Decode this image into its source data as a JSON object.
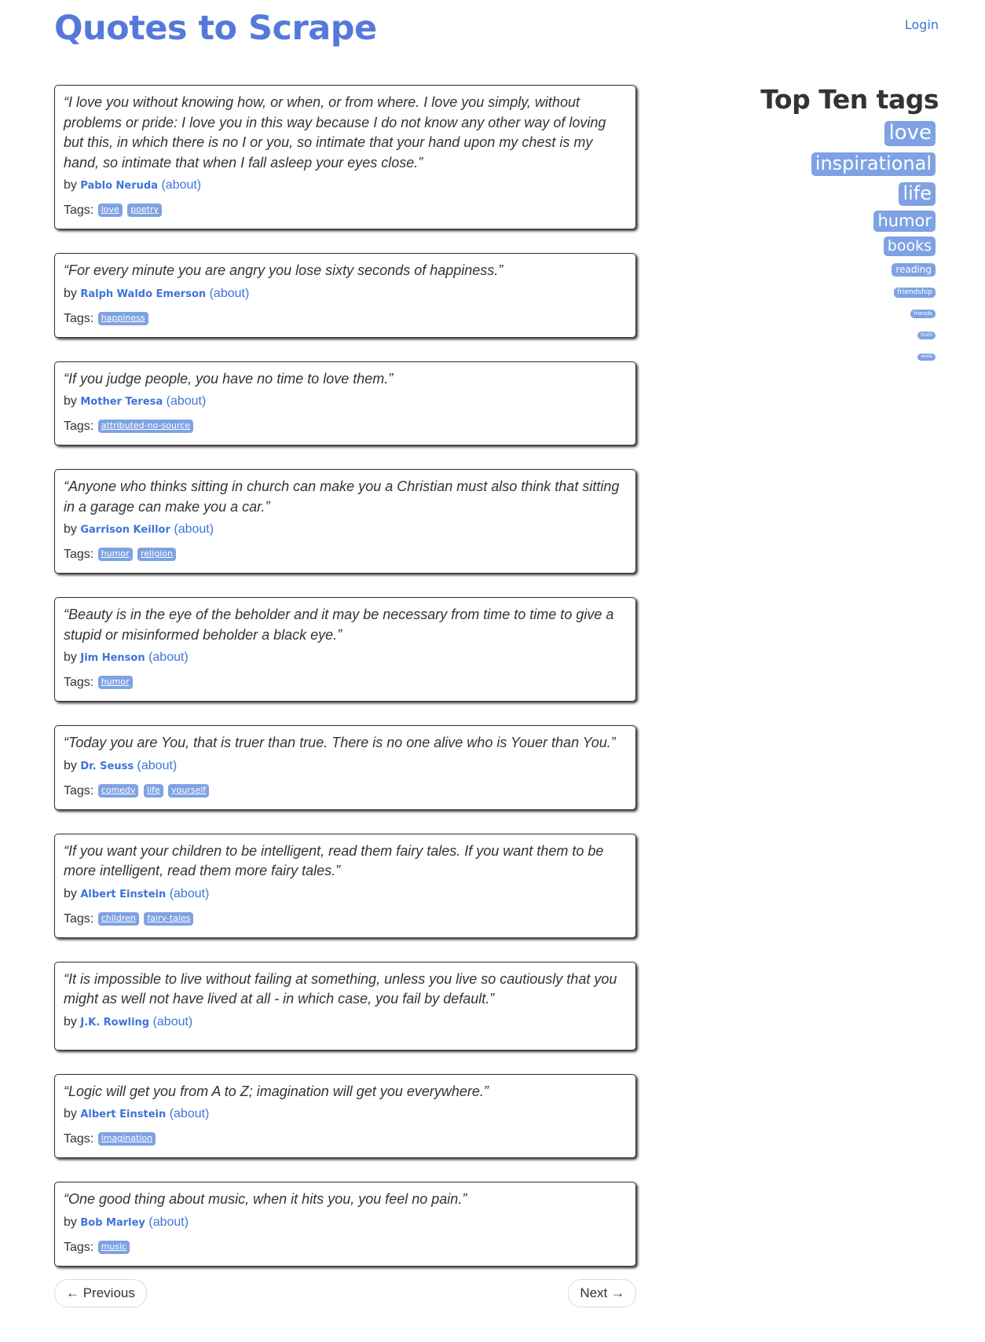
{
  "header": {
    "title": "Quotes to Scrape",
    "login": "Login"
  },
  "quotes": [
    {
      "text": "“I love you without knowing how, or when, or from where. I love you simply, without problems or pride: I love you in this way because I do not know any other way of loving but this, in which there is no I or you, so intimate that your hand upon my chest is my hand, so intimate that when I fall asleep your eyes close.”",
      "author": "Pablo Neruda",
      "tags": [
        "love",
        "poetry"
      ]
    },
    {
      "text": "“For every minute you are angry you lose sixty seconds of happiness.”",
      "author": "Ralph Waldo Emerson",
      "tags": [
        "happiness"
      ]
    },
    {
      "text": "“If you judge people, you have no time to love them.”",
      "author": "Mother Teresa",
      "tags": [
        "attributed-no-source"
      ]
    },
    {
      "text": "“Anyone who thinks sitting in church can make you a Christian must also think that sitting in a garage can make you a car.”",
      "author": "Garrison Keillor",
      "tags": [
        "humor",
        "religion"
      ]
    },
    {
      "text": "“Beauty is in the eye of the beholder and it may be necessary from time to time to give a stupid or misinformed beholder a black eye.”",
      "author": "Jim Henson",
      "tags": [
        "humor"
      ]
    },
    {
      "text": "“Today you are You, that is truer than true. There is no one alive who is Youer than You.”",
      "author": "Dr. Seuss",
      "tags": [
        "comedy",
        "life",
        "yourself"
      ]
    },
    {
      "text": "“If you want your children to be intelligent, read them fairy tales. If you want them to be more intelligent, read them more fairy tales.”",
      "author": "Albert Einstein",
      "tags": [
        "children",
        "fairy-tales"
      ]
    },
    {
      "text": "“It is impossible to live without failing at something, unless you live so cautiously that you might as well not have lived at all - in which case, you fail by default.”",
      "author": "J.K. Rowling",
      "tags": []
    },
    {
      "text": "“Logic will get you from A to Z; imagination will get you everywhere.”",
      "author": "Albert Einstein",
      "tags": [
        "imagination"
      ]
    },
    {
      "text": "“One good thing about music, when it hits you, you feel no pain.”",
      "author": "Bob Marley",
      "tags": [
        "music"
      ]
    }
  ],
  "labels": {
    "by": "by",
    "about": "(about)",
    "tags": "Tags:"
  },
  "sidebar": {
    "title": "Top Ten tags",
    "tags": [
      "love",
      "inspirational",
      "life",
      "humor",
      "books",
      "reading",
      "friendship",
      "friends",
      "truth",
      "simile"
    ]
  },
  "pager": {
    "previous": "← Previous",
    "next": "Next →"
  },
  "colors": {
    "brand": "#5579d9",
    "link": "#3f74d8",
    "tag_bg": "#7ea2e3"
  }
}
